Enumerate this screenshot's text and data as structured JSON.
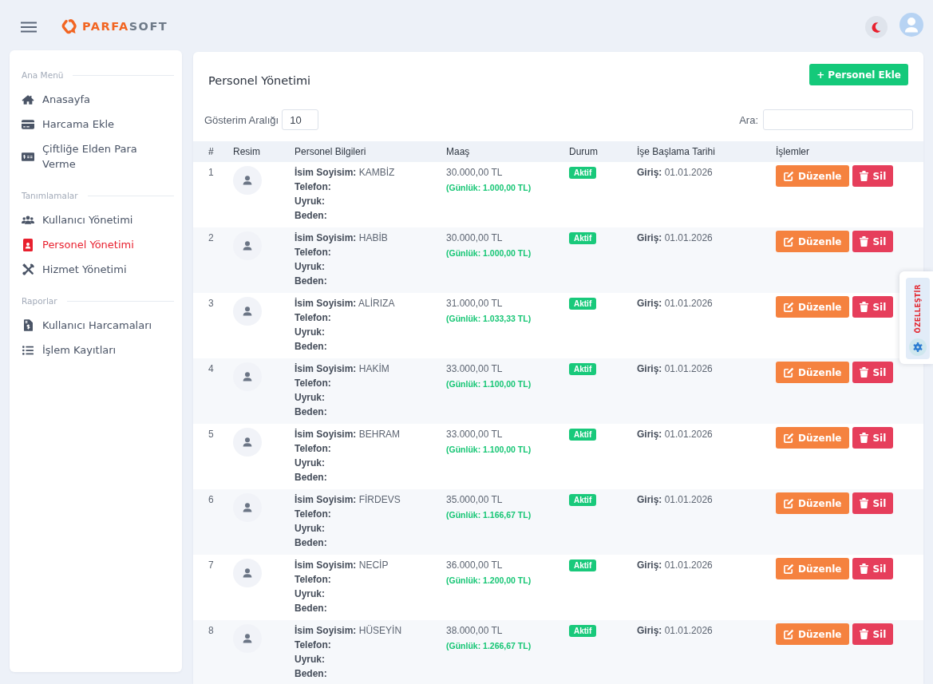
{
  "header": {
    "brand": {
      "accent": "PARFA",
      "rest": "SOFT"
    }
  },
  "sidebar": {
    "sections": [
      {
        "title": "Ana Menü",
        "items": [
          {
            "label": "Anasayfa",
            "selected": false
          },
          {
            "label": "Harcama Ekle",
            "selected": false
          },
          {
            "label": "Çiftliğe Elden Para Verme",
            "selected": false
          }
        ]
      },
      {
        "title": "Tanımlamalar",
        "items": [
          {
            "label": "Kullanıcı Yönetimi",
            "selected": false
          },
          {
            "label": "Personel Yönetimi",
            "selected": true
          },
          {
            "label": "Hizmet Yönetimi",
            "selected": false
          }
        ]
      },
      {
        "title": "Raporlar",
        "items": [
          {
            "label": "Kullanıcı Harcamaları",
            "selected": false
          },
          {
            "label": "İşlem Kayıtları",
            "selected": false
          }
        ]
      }
    ]
  },
  "page": {
    "title": "Personel Yönetimi",
    "add_button": "+ Personel Ekle",
    "page_size": {
      "label": "Gösterim Aralığı",
      "value": "10"
    },
    "search": {
      "label": "Ara:"
    }
  },
  "table": {
    "columns": [
      "#",
      "Resim",
      "Personel Bilgileri",
      "Maaş",
      "Durum",
      "İşe Başlama Tarihi",
      "İşlemler"
    ],
    "rows": [
      {
        "number": "1",
        "info": [
          {
            "label": "İsim Soyisim:",
            "value": "KAMBİZ"
          },
          {
            "label": "Telefon:"
          },
          {
            "label": "Uyruk:"
          },
          {
            "label": "Beden:"
          }
        ],
        "salary": "30.000,00 TL",
        "daily": "(Günlük: 1.000,00 TL)",
        "status": "Aktif",
        "start": {
          "label": "Giriş:",
          "value": "01.01.2026"
        },
        "actions": [
          {
            "kind": "edit",
            "label": "Düzenle"
          },
          {
            "kind": "delete",
            "label": "Sil"
          }
        ]
      },
      {
        "number": "2",
        "info": [
          {
            "label": "İsim Soyisim:",
            "value": "HABİB"
          },
          {
            "label": "Telefon:"
          },
          {
            "label": "Uyruk:"
          },
          {
            "label": "Beden:"
          }
        ],
        "salary": "30.000,00 TL",
        "daily": "(Günlük: 1.000,00 TL)",
        "status": "Aktif",
        "start": {
          "label": "Giriş:",
          "value": "01.01.2026"
        },
        "actions": [
          {
            "kind": "edit",
            "label": "Düzenle"
          },
          {
            "kind": "delete",
            "label": "Sil"
          }
        ]
      },
      {
        "number": "3",
        "info": [
          {
            "label": "İsim Soyisim:",
            "value": "ALİRIZA"
          },
          {
            "label": "Telefon:"
          },
          {
            "label": "Uyruk:"
          },
          {
            "label": "Beden:"
          }
        ],
        "salary": "31.000,00 TL",
        "daily": "(Günlük: 1.033,33 TL)",
        "status": "Aktif",
        "start": {
          "label": "Giriş:",
          "value": "01.01.2026"
        },
        "actions": [
          {
            "kind": "edit",
            "label": "Düzenle"
          },
          {
            "kind": "delete",
            "label": "Sil"
          }
        ]
      },
      {
        "number": "4",
        "info": [
          {
            "label": "İsim Soyisim:",
            "value": "HAKİM"
          },
          {
            "label": "Telefon:"
          },
          {
            "label": "Uyruk:"
          },
          {
            "label": "Beden:"
          }
        ],
        "salary": "33.000,00 TL",
        "daily": "(Günlük: 1.100,00 TL)",
        "status": "Aktif",
        "start": {
          "label": "Giriş:",
          "value": "01.01.2026"
        },
        "actions": [
          {
            "kind": "edit",
            "label": "Düzenle"
          },
          {
            "kind": "delete",
            "label": "Sil"
          }
        ]
      },
      {
        "number": "5",
        "info": [
          {
            "label": "İsim Soyisim:",
            "value": "BEHRAM"
          },
          {
            "label": "Telefon:"
          },
          {
            "label": "Uyruk:"
          },
          {
            "label": "Beden:"
          }
        ],
        "salary": "33.000,00 TL",
        "daily": "(Günlük: 1.100,00 TL)",
        "status": "Aktif",
        "start": {
          "label": "Giriş:",
          "value": "01.01.2026"
        },
        "actions": [
          {
            "kind": "edit",
            "label": "Düzenle"
          },
          {
            "kind": "delete",
            "label": "Sil"
          }
        ]
      },
      {
        "number": "6",
        "info": [
          {
            "label": "İsim Soyisim:",
            "value": "FİRDEVS"
          },
          {
            "label": "Telefon:"
          },
          {
            "label": "Uyruk:"
          },
          {
            "label": "Beden:"
          }
        ],
        "salary": "35.000,00 TL",
        "daily": "(Günlük: 1.166,67 TL)",
        "status": "Aktif",
        "start": {
          "label": "Giriş:",
          "value": "01.01.2026"
        },
        "actions": [
          {
            "kind": "edit",
            "label": "Düzenle"
          },
          {
            "kind": "delete",
            "label": "Sil"
          }
        ]
      },
      {
        "number": "7",
        "info": [
          {
            "label": "İsim Soyisim:",
            "value": "NECİP"
          },
          {
            "label": "Telefon:"
          },
          {
            "label": "Uyruk:"
          },
          {
            "label": "Beden:"
          }
        ],
        "salary": "36.000,00 TL",
        "daily": "(Günlük: 1.200,00 TL)",
        "status": "Aktif",
        "start": {
          "label": "Giriş:",
          "value": "01.01.2026"
        },
        "actions": [
          {
            "kind": "edit",
            "label": "Düzenle"
          },
          {
            "kind": "delete",
            "label": "Sil"
          }
        ]
      },
      {
        "number": "8",
        "info": [
          {
            "label": "İsim Soyisim:",
            "value": "HÜSEYİN"
          },
          {
            "label": "Telefon:"
          },
          {
            "label": "Uyruk:"
          },
          {
            "label": "Beden:"
          }
        ],
        "salary": "38.000,00 TL",
        "daily": "(Günlük: 1.266,67 TL)",
        "status": "Aktif",
        "start": {
          "label": "Giriş:",
          "value": "01.01.2026"
        },
        "actions": [
          {
            "kind": "edit",
            "label": "Düzenle"
          },
          {
            "kind": "delete",
            "label": "Sil"
          }
        ]
      }
    ]
  },
  "customize": {
    "label": "ÖZELLEŞTİR"
  }
}
